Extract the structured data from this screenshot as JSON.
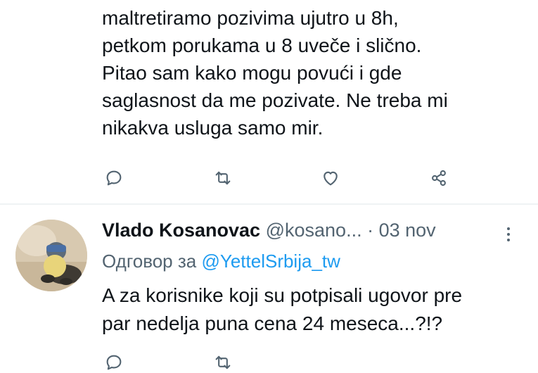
{
  "top_tweet": {
    "lines": [
      "maltretiramo pozivima ujutro u 8h,",
      "petkom porukama u 8 uveče i slično.",
      "Pitao sam kako mogu povući i gde",
      "saglasnost da me pozivate. Ne treba mi",
      "nikakva usluga samo mir."
    ]
  },
  "reply_tweet": {
    "name": "Vlado Kosanovac",
    "handle": "@kosano...",
    "separator": "·",
    "date": "03 nov",
    "reply_prefix": "Одговор за",
    "reply_mention": "@YettelSrbija_tw",
    "lines": [
      "A za korisnike koji su potpisali ugovor pre",
      "par nedelja puna cena 24 meseca...?!?"
    ]
  },
  "icons": [
    "reply-icon",
    "retweet-icon",
    "like-icon",
    "share-icon",
    "more-icon"
  ],
  "colors": {
    "text": "#0f1419",
    "secondary": "#536471",
    "link": "#1d9bf0",
    "divider": "#eff3f4"
  }
}
